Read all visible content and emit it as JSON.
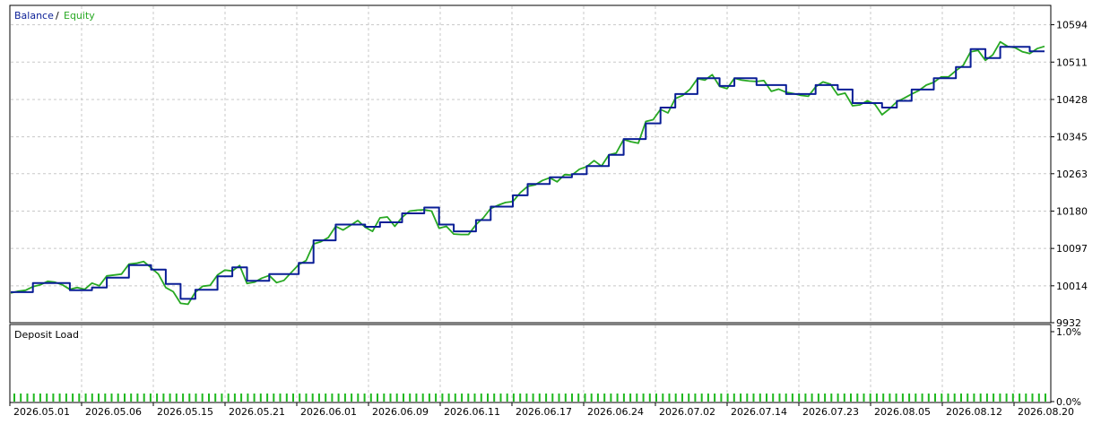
{
  "colors": {
    "background": "#ffffff",
    "frame": "#000000",
    "grid": "#c8c8c8",
    "balance": "#0a1e96",
    "equity": "#27a822",
    "deposit_load": "#1fb81f",
    "text": "#000000"
  },
  "chart_data": [
    {
      "type": "line",
      "legend": {
        "balance_label": "Balance",
        "separator": "/",
        "equity_label": "Equity",
        "placement": "top-left"
      },
      "grid": true,
      "ylim": [
        9932,
        10637
      ],
      "y_ticks": [
        "10594",
        "10511",
        "10428",
        "10345",
        "10263",
        "10180",
        "10097",
        "10014",
        "9932"
      ],
      "x_ticks": [
        "2026.05.01",
        "2026.05.06",
        "2026.05.15",
        "2026.05.21",
        "2026.06.01",
        "2026.06.09",
        "2026.06.11",
        "2026.06.17",
        "2026.06.24",
        "2026.07.02",
        "2026.07.14",
        "2026.07.23",
        "2026.08.05",
        "2026.08.12",
        "2026.08.20"
      ],
      "x": [
        0,
        3,
        6,
        9,
        12,
        15,
        18,
        21,
        24,
        27,
        30,
        33,
        36,
        39,
        42,
        45,
        48,
        51,
        54,
        57,
        60,
        63,
        66,
        69,
        72,
        75,
        78,
        81,
        84,
        87,
        90,
        93,
        96,
        99,
        102,
        105,
        108,
        111,
        114,
        117,
        120,
        123,
        126,
        129,
        132,
        135,
        138,
        141,
        144,
        147,
        150,
        153,
        156,
        159,
        162,
        165,
        168,
        171,
        174,
        177,
        180,
        183,
        186,
        189,
        192,
        195,
        198,
        201,
        204,
        207,
        210,
        213,
        216,
        219,
        222,
        225,
        228,
        231,
        234,
        237,
        240,
        243,
        246,
        249,
        252,
        255,
        258,
        261,
        264,
        267,
        270,
        273,
        276,
        279,
        282,
        285,
        288,
        291,
        294,
        297,
        300,
        303,
        306,
        309,
        312,
        315,
        318,
        321,
        324,
        327,
        330,
        333,
        336,
        339,
        342,
        345,
        348,
        351,
        354,
        357,
        360,
        363,
        366,
        369,
        372,
        375,
        378,
        381,
        384,
        387,
        390,
        393,
        396,
        399,
        402,
        405,
        408,
        411,
        414,
        417,
        420
      ],
      "series": [
        {
          "name": "Balance",
          "values": [
            10000,
            10000,
            10000,
            10020,
            10020,
            10020,
            10020,
            10020,
            10004,
            10004,
            10004,
            10010,
            10010,
            10032,
            10032,
            10032,
            10060,
            10060,
            10060,
            10050,
            10050,
            10018,
            10018,
            9985,
            9985,
            10005,
            10005,
            10005,
            10035,
            10035,
            10055,
            10055,
            10025,
            10025,
            10025,
            10040,
            10040,
            10040,
            10040,
            10065,
            10065,
            10115,
            10115,
            10115,
            10150,
            10150,
            10150,
            10150,
            10145,
            10145,
            10155,
            10155,
            10155,
            10175,
            10175,
            10175,
            10188,
            10188,
            10150,
            10150,
            10135,
            10135,
            10135,
            10160,
            10160,
            10190,
            10190,
            10190,
            10215,
            10215,
            10240,
            10240,
            10240,
            10255,
            10255,
            10255,
            10262,
            10262,
            10280,
            10280,
            10280,
            10305,
            10305,
            10340,
            10340,
            10340,
            10375,
            10375,
            10410,
            10410,
            10440,
            10440,
            10440,
            10475,
            10475,
            10475,
            10458,
            10458,
            10475,
            10475,
            10475,
            10460,
            10460,
            10460,
            10460,
            10440,
            10440,
            10440,
            10440,
            10460,
            10460,
            10460,
            10450,
            10450,
            10420,
            10420,
            10420,
            10420,
            10410,
            10410,
            10425,
            10425,
            10450,
            10450,
            10450,
            10475,
            10475,
            10475,
            10500,
            10500,
            10540,
            10540,
            10520,
            10520,
            10545,
            10545,
            10545,
            10545,
            10535,
            10535,
            10535
          ]
        },
        {
          "name": "Equity",
          "values": [
            9998,
            10002,
            10004,
            10012,
            10016,
            10024,
            10022,
            10016,
            10006,
            10010,
            10006,
            10020,
            10014,
            10036,
            10038,
            10040,
            10062,
            10064,
            10068,
            10054,
            10040,
            10010,
            10001,
            9975,
            9973,
            10000,
            10013,
            10015,
            10038,
            10049,
            10047,
            10059,
            10019,
            10022,
            10031,
            10037,
            10021,
            10026,
            10044,
            10061,
            10070,
            10107,
            10112,
            10121,
            10146,
            10138,
            10148,
            10159,
            10144,
            10135,
            10165,
            10167,
            10146,
            10166,
            10180,
            10182,
            10183,
            10180,
            10142,
            10146,
            10129,
            10128,
            10128,
            10150,
            10165,
            10186,
            10193,
            10199,
            10201,
            10221,
            10235,
            10238,
            10248,
            10254,
            10245,
            10261,
            10260,
            10273,
            10279,
            10292,
            10280,
            10305,
            10309,
            10339,
            10334,
            10331,
            10379,
            10383,
            10406,
            10398,
            10430,
            10437,
            10451,
            10474,
            10471,
            10483,
            10457,
            10452,
            10475,
            10471,
            10469,
            10468,
            10470,
            10446,
            10451,
            10444,
            10441,
            10437,
            10435,
            10456,
            10467,
            10462,
            10438,
            10442,
            10414,
            10416,
            10425,
            10418,
            10394,
            10407,
            10423,
            10431,
            10440,
            10448,
            10460,
            10466,
            10478,
            10478,
            10492,
            10504,
            10534,
            10537,
            10515,
            10527,
            10556,
            10546,
            10543,
            10534,
            10530,
            10541,
            10546
          ]
        }
      ]
    },
    {
      "type": "bar",
      "title": "Deposit Load",
      "y_ticks": [
        "1.0%",
        "0.0%"
      ],
      "ylim": [
        0,
        1.0
      ],
      "bar_count": 160,
      "bar_value": 0.0
    }
  ]
}
